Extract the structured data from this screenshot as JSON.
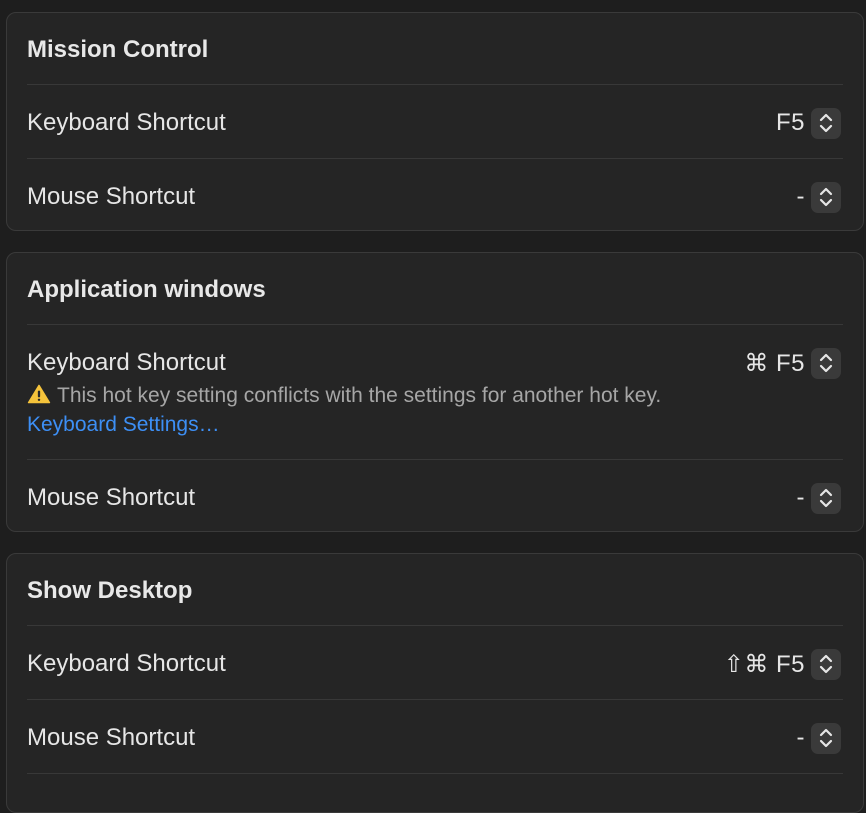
{
  "sections": [
    {
      "title": "Mission Control",
      "rows": [
        {
          "label": "Keyboard Shortcut",
          "value": "F5"
        },
        {
          "label": "Mouse Shortcut",
          "value": "-"
        }
      ]
    },
    {
      "title": "Application windows",
      "rows": [
        {
          "label": "Keyboard Shortcut",
          "value": "⌘ F5",
          "warning": "This hot key setting conflicts with the settings for another hot key.",
          "warning_link": "Keyboard Settings…"
        },
        {
          "label": "Mouse Shortcut",
          "value": "-"
        }
      ]
    },
    {
      "title": "Show Desktop",
      "rows": [
        {
          "label": "Keyboard Shortcut",
          "value": "⇧⌘ F5"
        },
        {
          "label": "Mouse Shortcut",
          "value": "-"
        }
      ]
    }
  ],
  "icons": {
    "warning": "warning-triangle-icon",
    "stepper": "up-down-chevron-icon"
  },
  "colors": {
    "background": "#1e1e1e",
    "panel": "#252525",
    "link": "#3d8ff5",
    "warning_icon": "#f5c33b"
  }
}
